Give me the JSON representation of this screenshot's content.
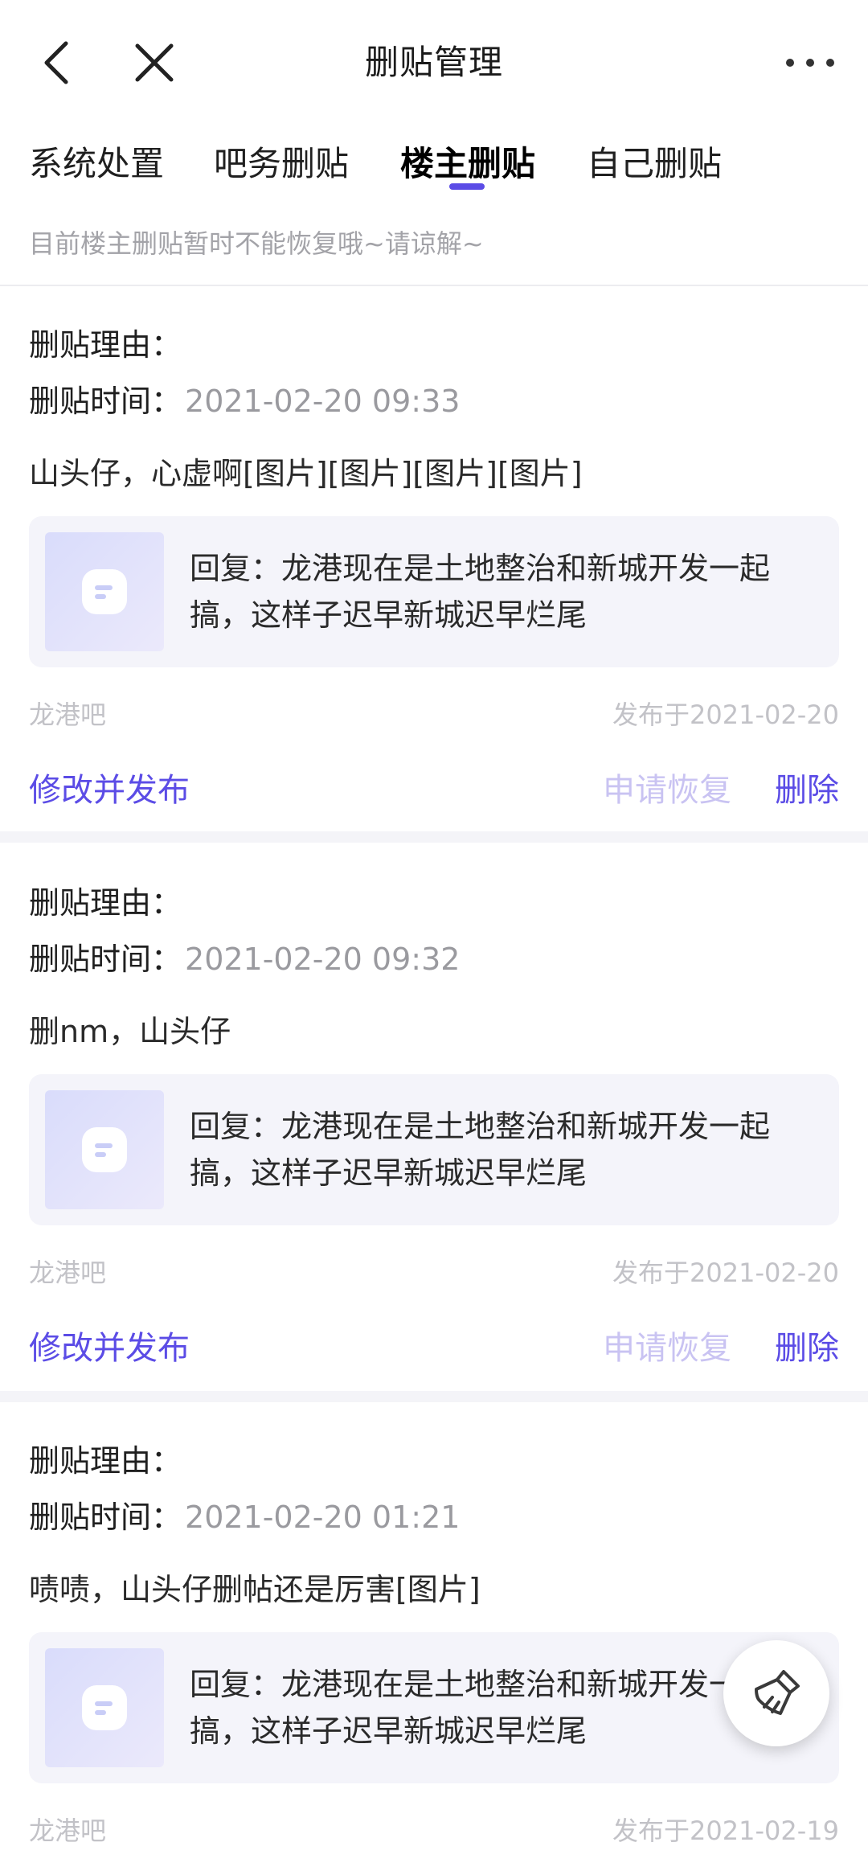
{
  "header": {
    "title": "删贴管理",
    "back_icon": "back-arrow-icon",
    "close_icon": "close-icon",
    "more_icon": "more-dots-icon"
  },
  "tabs": [
    {
      "label": "系统处置",
      "active": false
    },
    {
      "label": "吧务删贴",
      "active": false
    },
    {
      "label": "楼主删贴",
      "active": true
    },
    {
      "label": "自己删贴",
      "active": false
    }
  ],
  "notice": "目前楼主删贴暂时不能恢复哦~请谅解~",
  "accent_color": "#5b4ce6",
  "posts": [
    {
      "reason_label": "删贴理由：",
      "time_label": "删贴时间：",
      "time": "2021-02-20 09:33",
      "content": "山头仔，心虚啊[图片][图片][图片][图片]",
      "quote": "回复：龙港现在是土地整治和新城开发一起搞，这样子迟早新城迟早烂尾",
      "forum": "龙港吧",
      "published": "发布于2021-02-20",
      "edit_label": "修改并发布",
      "restore_label": "申请恢复",
      "delete_label": "删除"
    },
    {
      "reason_label": "删贴理由：",
      "time_label": "删贴时间：",
      "time": "2021-02-20 09:32",
      "content": "删nm，山头仔",
      "quote": "回复：龙港现在是土地整治和新城开发一起搞，这样子迟早新城迟早烂尾",
      "forum": "龙港吧",
      "published": "发布于2021-02-20",
      "edit_label": "修改并发布",
      "restore_label": "申请恢复",
      "delete_label": "删除"
    },
    {
      "reason_label": "删贴理由：",
      "time_label": "删贴时间：",
      "time": "2021-02-20 01:21",
      "content": "啧啧，山头仔删帖还是厉害[图片]",
      "quote": "回复：龙港现在是土地整治和新城开发一起搞，这样子迟早新城迟早烂尾",
      "forum": "龙港吧",
      "published": "发布于2021-02-19"
    }
  ],
  "fab_icon": "broom-icon"
}
